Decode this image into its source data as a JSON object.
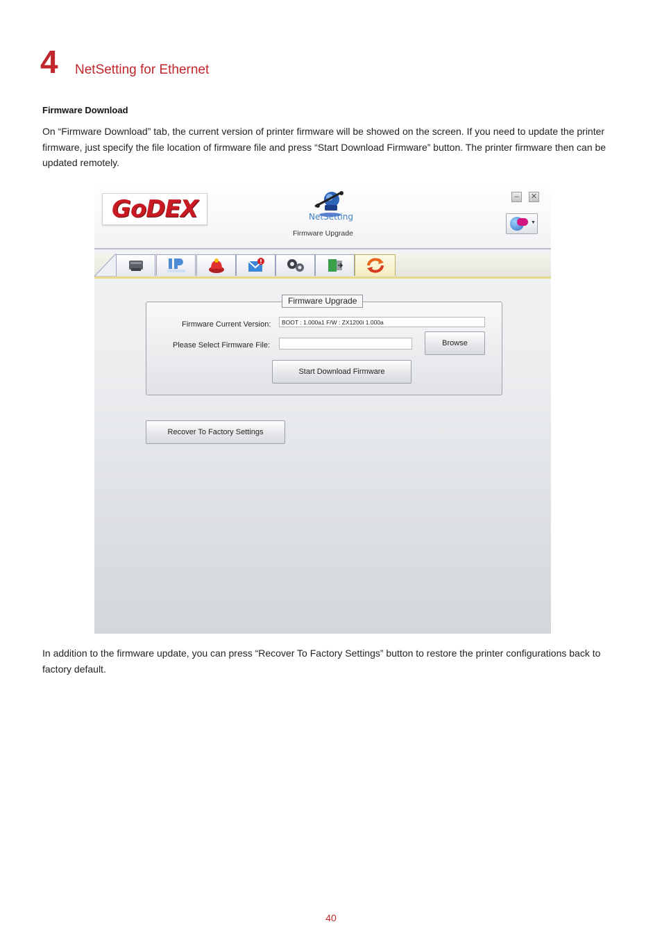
{
  "chapter": {
    "number": "4",
    "title": "NetSetting for Ethernet"
  },
  "section": {
    "heading": "Firmware Download"
  },
  "intro": "On “Firmware Download” tab, the current version of printer firmware will be showed on the screen. If you need to update the printer firmware, just specify the file location of firmware file and press “Start Download Firmware” button. The printer firmware then can be updated remotely.",
  "app": {
    "logo": "GoDEX",
    "netsetting_name": "NetSetting",
    "subtitle": "Firmware Upgrade",
    "window_buttons": {
      "minimize": "–",
      "close": "✕"
    },
    "tabs": [
      {
        "icon": "printer-icon"
      },
      {
        "icon": "ip-network-icon",
        "text": "IP"
      },
      {
        "icon": "alarm-bell-icon"
      },
      {
        "icon": "email-alert-icon"
      },
      {
        "icon": "gears-icon"
      },
      {
        "icon": "door-exit-icon"
      },
      {
        "icon": "refresh-arrows-icon",
        "active": true
      }
    ],
    "group": {
      "legend": "Firmware Upgrade",
      "current_version_label": "Firmware Current Version:",
      "current_version_value": "BOOT : 1.000a1 F/W : ZX1200i 1.000a",
      "select_file_label": "Please Select Firmware File:",
      "select_file_value": "",
      "browse_label": "Browse",
      "start_download_label": "Start Download Firmware"
    },
    "recover_label": "Recover To Factory  Settings",
    "colors": {
      "brand_red": "#c81a22",
      "accent_blue": "#3d7fc2",
      "active_tab": "#f5edbe"
    }
  },
  "outro": "In addition to the firmware update, you can press “Recover To Factory Settings” button to restore the printer configurations back to factory default.",
  "page_number": "40"
}
